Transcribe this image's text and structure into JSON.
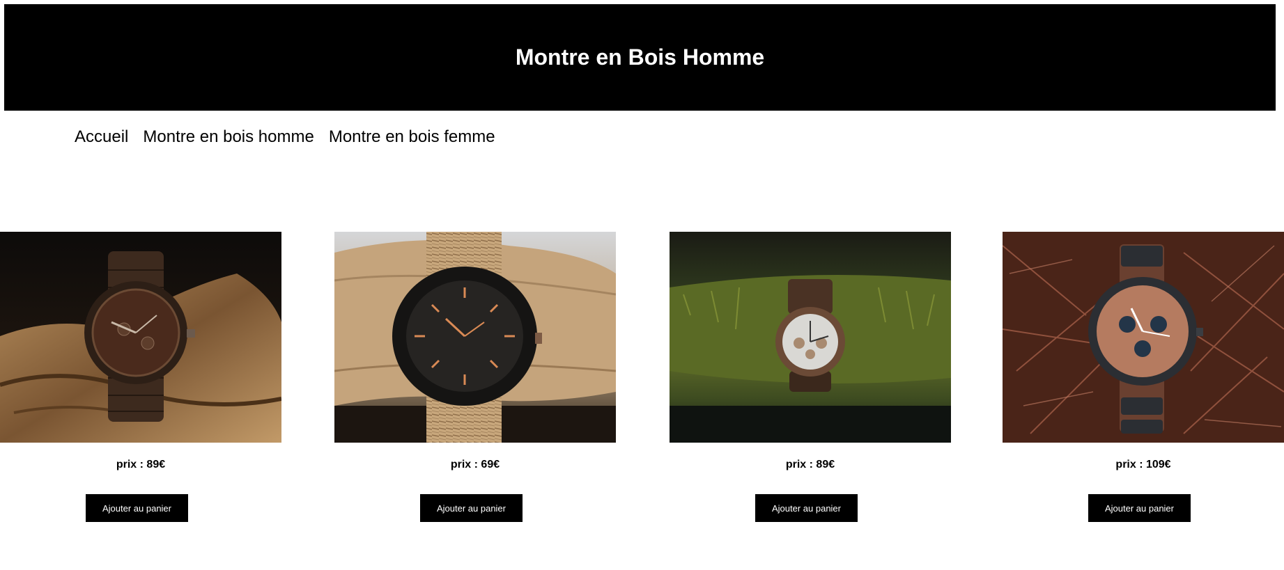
{
  "header": {
    "title": "Montre en Bois Homme"
  },
  "nav": {
    "items": [
      {
        "label": "Accueil"
      },
      {
        "label": "Montre en bois homme"
      },
      {
        "label": "Montre en bois femme"
      }
    ]
  },
  "products": [
    {
      "price_label": "prix : 89€",
      "button_label": "Ajouter au panier"
    },
    {
      "price_label": "prix : 69€",
      "button_label": "Ajouter au panier"
    },
    {
      "price_label": "prix : 89€",
      "button_label": "Ajouter au panier"
    },
    {
      "price_label": "prix : 109€",
      "button_label": "Ajouter au panier"
    }
  ],
  "colors": {
    "header_bg": "#000000",
    "button_bg": "#000000",
    "button_text": "#ffffff"
  }
}
